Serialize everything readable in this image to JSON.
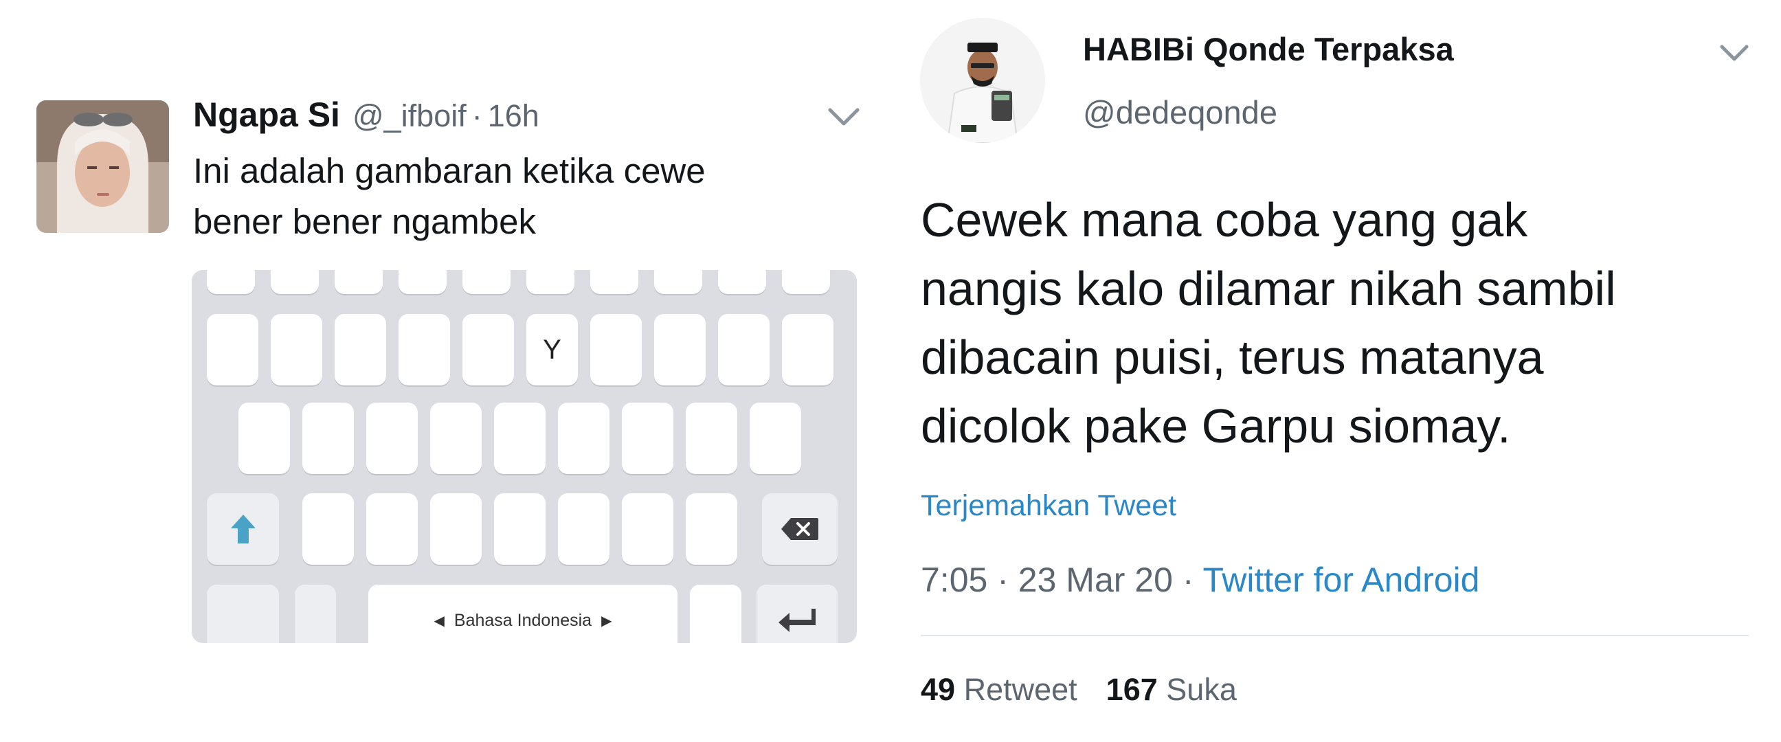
{
  "left_tweet": {
    "author_name": "Ngapa Si",
    "handle": "@_ifboif",
    "separator": "·",
    "time": "16h",
    "text_line1": "Ini adalah gambaran ketika cewe",
    "text_line2": "bener bener ngambek",
    "keyboard": {
      "visible_key": "Y",
      "language_label": "Bahasa Indonesia",
      "shift_icon": "shift-arrow-icon",
      "backspace_icon": "backspace-icon",
      "enter_icon": "enter-icon",
      "key_color": "#ffffff",
      "background_color": "#dcdde2",
      "accent_color": "#4aa3c7"
    }
  },
  "right_tweet": {
    "author_name": "HABIBi Qonde Terpaksa",
    "handle": "@dedeqonde",
    "text_line1": "Cewek mana coba yang gak",
    "text_line2": "nangis kalo dilamar nikah sambil",
    "text_line3": "dibacain puisi, terus matanya",
    "text_line4": "dicolok pake Garpu siomay.",
    "translate_link": "Terjemahkan Tweet",
    "time": "7:05",
    "date": "23 Mar 20",
    "separator": "·",
    "source": "Twitter for Android",
    "retweet_count": "49",
    "retweet_label": "Retweet",
    "like_count": "167",
    "like_label": "Suka",
    "link_color": "#2a87c8"
  }
}
